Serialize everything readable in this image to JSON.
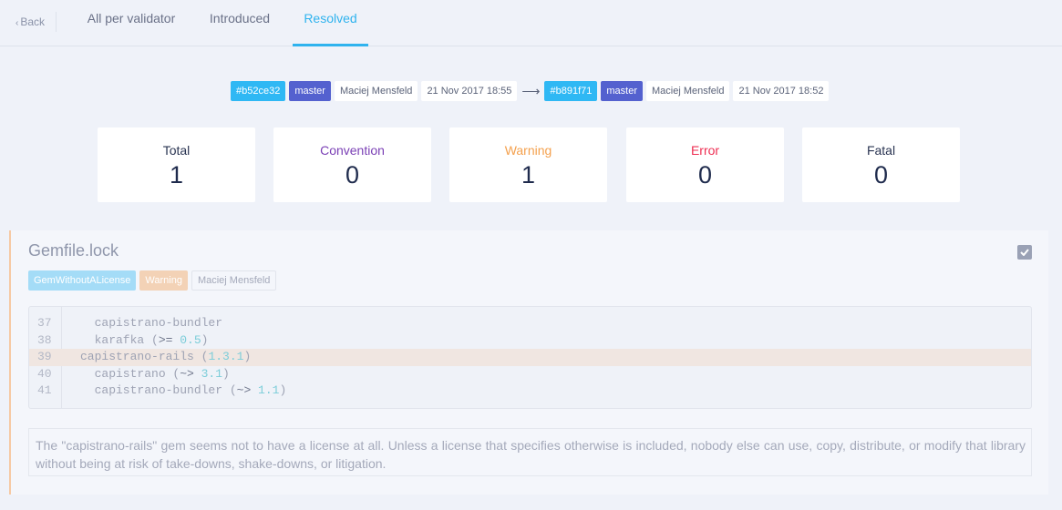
{
  "nav": {
    "back_label": "Back",
    "tabs": [
      {
        "label": "All per validator",
        "active": false
      },
      {
        "label": "Introduced",
        "active": false
      },
      {
        "label": "Resolved",
        "active": true
      }
    ]
  },
  "comparison": {
    "from": {
      "sha": "#b52ce32",
      "branch": "master",
      "author": "Maciej Mensfeld",
      "date": "21 Nov 2017 18:55"
    },
    "arrow_icon": "arrow-right-icon",
    "to": {
      "sha": "#b891f71",
      "branch": "master",
      "author": "Maciej Mensfeld",
      "date": "21 Nov 2017 18:52"
    }
  },
  "stats": [
    {
      "label": "Total",
      "value": "1",
      "color": "#2a3452"
    },
    {
      "label": "Convention",
      "value": "0",
      "color": "#7a3fb5"
    },
    {
      "label": "Warning",
      "value": "1",
      "color": "#f4a14e"
    },
    {
      "label": "Error",
      "value": "0",
      "color": "#ee2e52"
    },
    {
      "label": "Fatal",
      "value": "0",
      "color": "#2a3452"
    }
  ],
  "issue": {
    "file": "Gemfile.lock",
    "checkbox_icon": "checkmark-icon",
    "validator": "GemWithoutALicense",
    "level": "Warning",
    "author": "Maciej Mensfeld",
    "code": [
      {
        "line": "37",
        "indent": "  ",
        "text": "capistrano-bundler",
        "op": "",
        "version": "",
        "close": "",
        "highlight": false
      },
      {
        "line": "38",
        "indent": "  ",
        "text": "karafka (",
        "op": ">= ",
        "version": "0.5",
        "close": ")",
        "highlight": false
      },
      {
        "line": "39",
        "indent": "",
        "text": "capistrano-rails (",
        "op": "",
        "version": "1.3.1",
        "close": ")",
        "highlight": true
      },
      {
        "line": "40",
        "indent": "  ",
        "text": "capistrano (",
        "op": "~> ",
        "version": "3.1",
        "close": ")",
        "highlight": false
      },
      {
        "line": "41",
        "indent": "  ",
        "text": "capistrano-bundler (",
        "op": "~> ",
        "version": "1.1",
        "close": ")",
        "highlight": false
      }
    ],
    "description": "The \"capistrano-rails\" gem seems not to have a license at all. Unless a license that specifies otherwise is included, nobody else can use, copy, distribute, or modify that library without being at risk of take-downs, shake-downs, or litigation."
  }
}
